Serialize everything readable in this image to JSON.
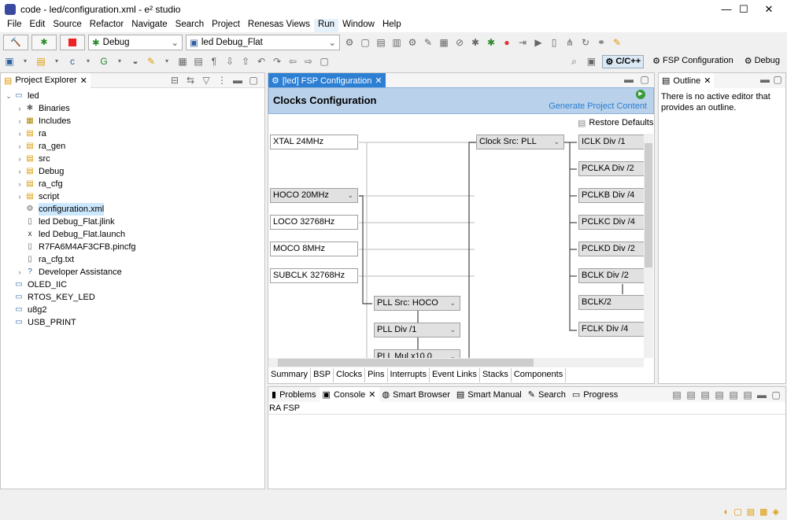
{
  "window": {
    "title": "code - led/configuration.xml - e² studio",
    "minimize": "—",
    "maximize": "☐",
    "close": "✕"
  },
  "menu": [
    "File",
    "Edit",
    "Source",
    "Refactor",
    "Navigate",
    "Search",
    "Project",
    "Renesas Views",
    "Run",
    "Window",
    "Help"
  ],
  "toolbar": {
    "build_icon": "hammer-icon",
    "debug_icon": "bug-icon",
    "stop_icon": "stop-icon",
    "launch_mode": "Debug",
    "launch_config": "led Debug_Flat"
  },
  "perspectives": [
    {
      "label": "C/C++",
      "active": true
    },
    {
      "label": "FSP Configuration",
      "active": false
    },
    {
      "label": "Debug",
      "active": false
    }
  ],
  "project_explorer": {
    "title": "Project Explorer",
    "items": [
      {
        "label": "led",
        "level": 0,
        "expanded": true,
        "icon": "project"
      },
      {
        "label": "Binaries",
        "level": 1,
        "icon": "binaries"
      },
      {
        "label": "Includes",
        "level": 1,
        "icon": "includes"
      },
      {
        "label": "ra",
        "level": 1,
        "icon": "folder"
      },
      {
        "label": "ra_gen",
        "level": 1,
        "icon": "folder"
      },
      {
        "label": "src",
        "level": 1,
        "icon": "folder"
      },
      {
        "label": "Debug",
        "level": 1,
        "icon": "folder"
      },
      {
        "label": "ra_cfg",
        "level": 1,
        "icon": "folder"
      },
      {
        "label": "script",
        "level": 1,
        "icon": "folder"
      },
      {
        "label": "configuration.xml",
        "level": 1,
        "icon": "gear",
        "selected": true
      },
      {
        "label": "led Debug_Flat.jlink",
        "level": 1,
        "icon": "file"
      },
      {
        "label": "led Debug_Flat.launch",
        "level": 1,
        "icon": "launch"
      },
      {
        "label": "R7FA6M4AF3CFB.pincfg",
        "level": 1,
        "icon": "file"
      },
      {
        "label": "ra_cfg.txt",
        "level": 1,
        "icon": "file"
      },
      {
        "label": "Developer Assistance",
        "level": 1,
        "icon": "help"
      },
      {
        "label": "OLED_IIC",
        "level": 0,
        "icon": "project"
      },
      {
        "label": "RTOS_KEY_LED",
        "level": 0,
        "icon": "project"
      },
      {
        "label": "u8g2",
        "level": 0,
        "icon": "project"
      },
      {
        "label": "USB_PRINT",
        "level": 0,
        "icon": "project"
      }
    ]
  },
  "editor": {
    "tab": "[led] FSP Configuration",
    "heading": "Clocks Configuration",
    "generate": "Generate Project Content",
    "restore": "Restore Defaults",
    "sources": [
      "XTAL 24MHz",
      "HOCO 20MHz",
      "LOCO 32768Hz",
      "MOCO 8MHz",
      "SUBCLK 32768Hz"
    ],
    "pll": [
      "PLL Src: HOCO",
      "PLL Div /1",
      "PLL Mul x10.0"
    ],
    "clock_src": "Clock Src: PLL",
    "dividers": [
      "ICLK Div /1",
      "PCLKA Div /2",
      "PCLKB Div /4",
      "PCLKC Div /4",
      "PCLKD Div /2",
      "BCLK Div /2",
      "BCLK/2",
      "FCLK Div /4"
    ],
    "bottom_tabs": [
      "Summary",
      "BSP",
      "Clocks",
      "Pins",
      "Interrupts",
      "Event Links",
      "Stacks",
      "Components"
    ],
    "active_bottom_tab": "Clocks"
  },
  "outline": {
    "title": "Outline",
    "message": "There is no active editor that provides an outline."
  },
  "console": {
    "tabs": [
      "Problems",
      "Console",
      "Smart Browser",
      "Smart Manual",
      "Search",
      "Progress"
    ],
    "active": "Console",
    "label": "RA FSP"
  },
  "colors": {
    "accent": "#2d7fd4",
    "header_bg": "#b9d1ea",
    "link": "#2a7ed2"
  }
}
